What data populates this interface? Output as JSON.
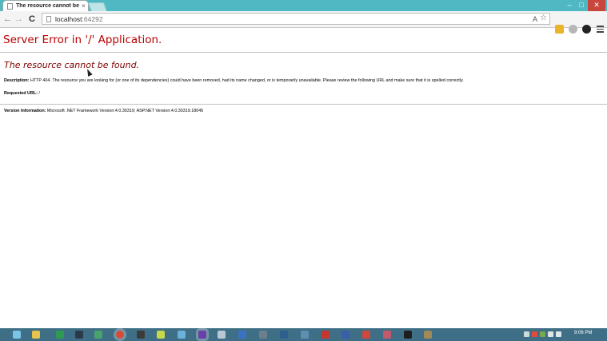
{
  "browser": {
    "tab_title": "The resource cannot be fo",
    "tab_close": "×",
    "url_host": "localhost",
    "url_port": ":64292",
    "window_controls": {
      "minimize": "–",
      "maximize": "□",
      "close": "✕"
    },
    "nav": {
      "back": "←",
      "forward": "→",
      "reload": "C"
    },
    "omnibox_icons": {
      "left": "A",
      "right": "☆"
    },
    "extension_icons": [
      "yellow-extension-icon",
      "gray-extension-icon",
      "dark-extension-icon"
    ]
  },
  "page": {
    "title": "Server Error in '/' Application.",
    "subtitle": "The resource cannot be found.",
    "description_label": "Description:",
    "description_text": " HTTP 404. The resource you are looking for (or one of its dependencies) could have been removed, had its name changed, or is temporarily unavailable.  Please review the following URL and make sure that it is spelled correctly.",
    "requested_url_label": "Requested URL:",
    "requested_url_value": " /",
    "version_label": "Version Information:",
    "version_text": " Microsoft .NET Framework Version:4.0.30319; ASP.NET Version:4.0.30319.18045"
  },
  "taskbar": {
    "apps": [
      "start",
      "explorer",
      "excel",
      "steam",
      "app",
      "chrome",
      "media",
      "torrent",
      "app",
      "visual-studio",
      "camera",
      "app",
      "calculator",
      "app",
      "app",
      "filezilla",
      "app",
      "app",
      "terminal",
      "app"
    ],
    "clock": "9:06 PM"
  },
  "colors": {
    "title_bar": "#4fb8c3",
    "heading_red": "#bb0000",
    "subheading_maroon": "#800000",
    "taskbar": "#3f6f86"
  }
}
